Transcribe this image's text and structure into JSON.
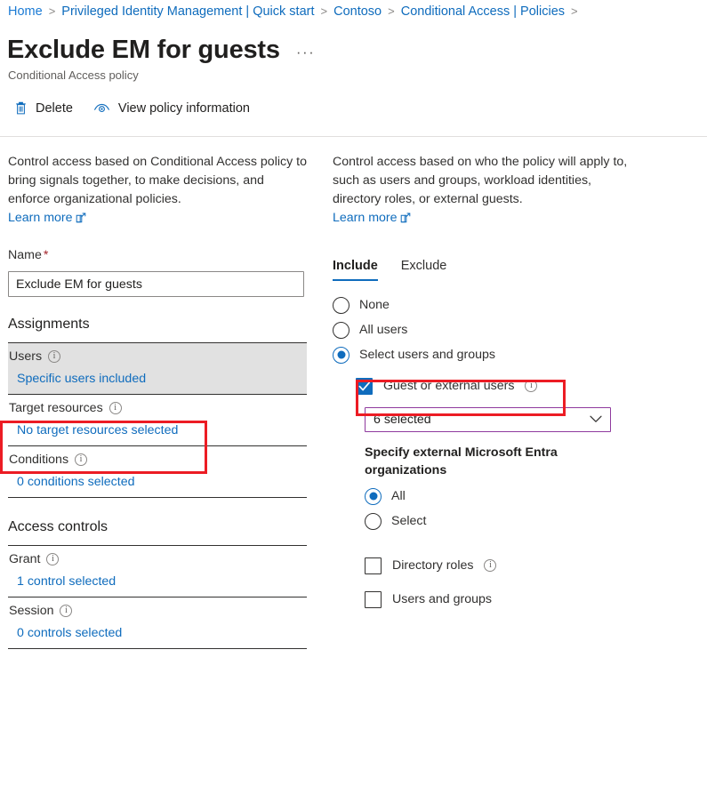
{
  "breadcrumb": {
    "items": [
      {
        "label": "Home"
      },
      {
        "label": "Privileged Identity Management | Quick start"
      },
      {
        "label": "Contoso"
      },
      {
        "label": "Conditional Access | Policies"
      }
    ],
    "separator": ">"
  },
  "header": {
    "title": "Exclude EM for guests",
    "subtitle": "Conditional Access policy",
    "more_label": "···"
  },
  "commandbar": {
    "delete_label": "Delete",
    "view_policy_label": "View policy information"
  },
  "left": {
    "description": "Control access based on Conditional Access policy to bring signals together, to make decisions, and enforce organizational policies.",
    "learn_more": "Learn more",
    "name_label": "Name",
    "name_required": "*",
    "name_value": "Exclude EM for guests",
    "assignments_heading": "Assignments",
    "rows": [
      {
        "title": "Users",
        "value": "Specific users included",
        "selected": true
      },
      {
        "title": "Target resources",
        "value": "No target resources selected",
        "selected": false
      },
      {
        "title": "Conditions",
        "value": "0 conditions selected",
        "selected": false
      }
    ],
    "access_controls_heading": "Access controls",
    "control_rows": [
      {
        "title": "Grant",
        "value": "1 control selected"
      },
      {
        "title": "Session",
        "value": "0 controls selected"
      }
    ]
  },
  "right": {
    "description": "Control access based on who the policy will apply to, such as users and groups, workload identities, directory roles, or external guests.",
    "learn_more": "Learn more",
    "tabs": [
      {
        "label": "Include",
        "active": true
      },
      {
        "label": "Exclude",
        "active": false
      }
    ],
    "radios": [
      {
        "label": "None",
        "checked": false
      },
      {
        "label": "All users",
        "checked": false
      },
      {
        "label": "Select users and groups",
        "checked": true
      }
    ],
    "guest_checkbox": {
      "label": "Guest or external users",
      "checked": true
    },
    "dropdown": {
      "value": "6 selected"
    },
    "specify_heading": "Specify external Microsoft Entra organizations",
    "org_radios": [
      {
        "label": "All",
        "checked": true
      },
      {
        "label": "Select",
        "checked": false
      }
    ],
    "extra_checkboxes": [
      {
        "label": "Directory roles",
        "checked": false,
        "info": true
      },
      {
        "label": "Users and groups",
        "checked": false,
        "info": false
      }
    ]
  },
  "colors": {
    "link": "#0f6cbd",
    "accent": "#0f6cbd",
    "required": "#a4262c",
    "highlight_box": "#ec1c24",
    "dropdown_border": "#8f3a9e",
    "selected_row": "#e1e1e1"
  }
}
